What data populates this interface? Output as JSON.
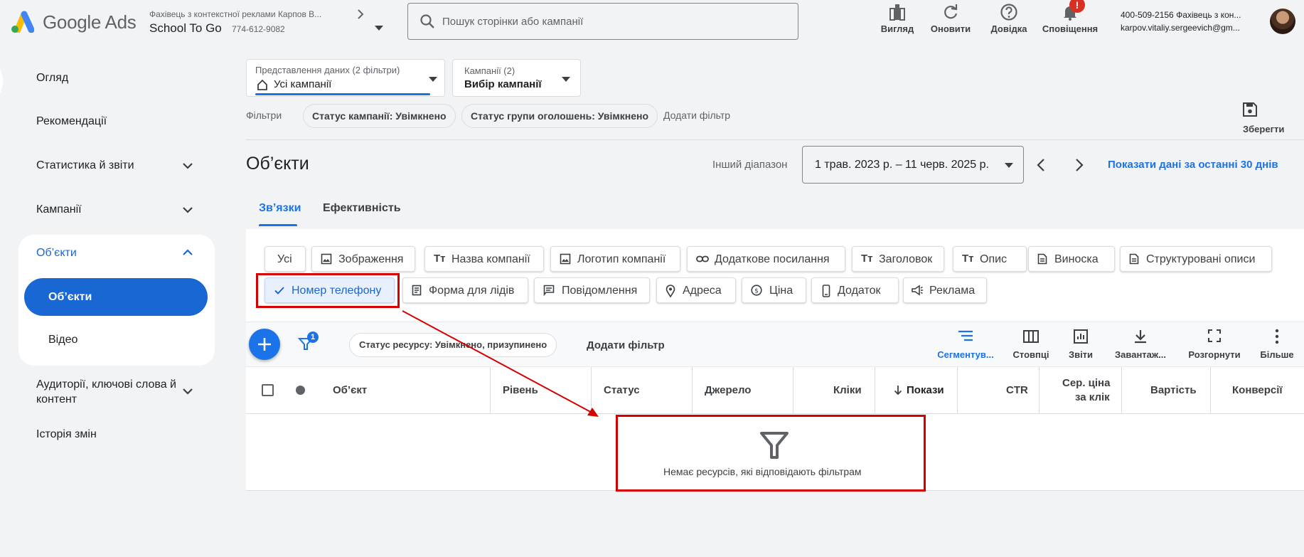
{
  "header": {
    "logo_text": "Google Ads",
    "account_line1": "Фахівець з контекстної реклами Карпов В...",
    "account_name": "School To Go",
    "account_id": "774-612-9082",
    "search_placeholder": "Пошук сторінки або кампанії",
    "buttons": [
      {
        "label": "Вигляд",
        "icon": "appearance-icon"
      },
      {
        "label": "Оновити",
        "icon": "refresh-icon"
      },
      {
        "label": "Довідка",
        "icon": "help-icon"
      },
      {
        "label": "Сповіщення",
        "icon": "bell-icon",
        "badge": "!"
      }
    ],
    "user_line1": "400-509-2156 Фахівець з кон...",
    "user_line2": "karpov.vitaliy.sergeevich@gm..."
  },
  "sidebar": {
    "items": [
      {
        "label": "Огляд"
      },
      {
        "label": "Рекомендації"
      },
      {
        "label": "Статистика й звіти"
      },
      {
        "label": "Кампанії"
      },
      {
        "label": "Об’єкти"
      },
      {
        "label": "Об’єкти"
      },
      {
        "label": "Відео"
      },
      {
        "label": "Аудиторії, ключові слова й контент"
      },
      {
        "label": "Історія змін"
      }
    ]
  },
  "view": {
    "data_view_label": "Представлення даних (2 фільтри)",
    "data_view_value": "Усі кампанії",
    "campaigns_label": "Кампанії (2)",
    "campaigns_value": "Вибір кампанії"
  },
  "filters": {
    "label": "Фільтри",
    "chips": [
      "Статус кампанії: Увімкнено",
      "Статус групи оголошень: Увімкнено"
    ],
    "add": "Додати фільтр",
    "save": "Зберегти"
  },
  "page": {
    "title": "Об’єкти",
    "range_label": "Інший діапазон",
    "date_range": "1 трав. 2023 р. – 11 черв. 2025 р.",
    "last30": "Показати дані за останні 30 днів",
    "tabs": [
      "Зв’язки",
      "Ефективність"
    ]
  },
  "type_chips": [
    {
      "label": "Усі",
      "icon": ""
    },
    {
      "label": "Зображення",
      "icon": "image-icon"
    },
    {
      "label": "Назва компанії",
      "icon": "text-icon"
    },
    {
      "label": "Логотип компанії",
      "icon": "image-icon"
    },
    {
      "label": "Додаткове посилання",
      "icon": "link-icon"
    },
    {
      "label": "Заголовок",
      "icon": "text-icon"
    },
    {
      "label": "Опис",
      "icon": "text-icon"
    },
    {
      "label": "Виноска",
      "icon": "document-icon"
    },
    {
      "label": "Структуровані описи",
      "icon": "document-icon"
    },
    {
      "label": "Номер телефону",
      "icon": "check-icon",
      "selected": true
    },
    {
      "label": "Форма для лідів",
      "icon": "form-icon"
    },
    {
      "label": "Повідомлення",
      "icon": "message-icon"
    },
    {
      "label": "Адреса",
      "icon": "location-icon"
    },
    {
      "label": "Ціна",
      "icon": "price-icon"
    },
    {
      "label": "Додаток",
      "icon": "phone-app-icon"
    },
    {
      "label": "Реклама",
      "icon": "megaphone-icon"
    }
  ],
  "table_toolbar": {
    "filter_badge": "1",
    "filter_chip": "Статус ресурсу: Увімкнено, призупинено",
    "add_filter": "Додати фільтр",
    "tools": [
      {
        "label": "Сегментув...",
        "icon": "segment-icon",
        "active": true
      },
      {
        "label": "Стовпці",
        "icon": "columns-icon"
      },
      {
        "label": "Звіти",
        "icon": "reports-icon"
      },
      {
        "label": "Завантаж...",
        "icon": "download-icon"
      },
      {
        "label": "Розгорнути",
        "icon": "expand-icon"
      },
      {
        "label": "Більше",
        "icon": "more-icon"
      }
    ]
  },
  "table": {
    "columns": [
      "Об’єкт",
      "Рівень",
      "Статус",
      "Джерело",
      "Кліки",
      "Покази",
      "CTR",
      "Сер. ціна",
      "за клік",
      "Вартість",
      "Конверсії"
    ],
    "empty_message": "Немає ресурсів, які відповідають фільтрам"
  },
  "colors": {
    "accent": "#1a73e8",
    "active_nav": "#1967d2",
    "annotation_red": "#d50000"
  }
}
